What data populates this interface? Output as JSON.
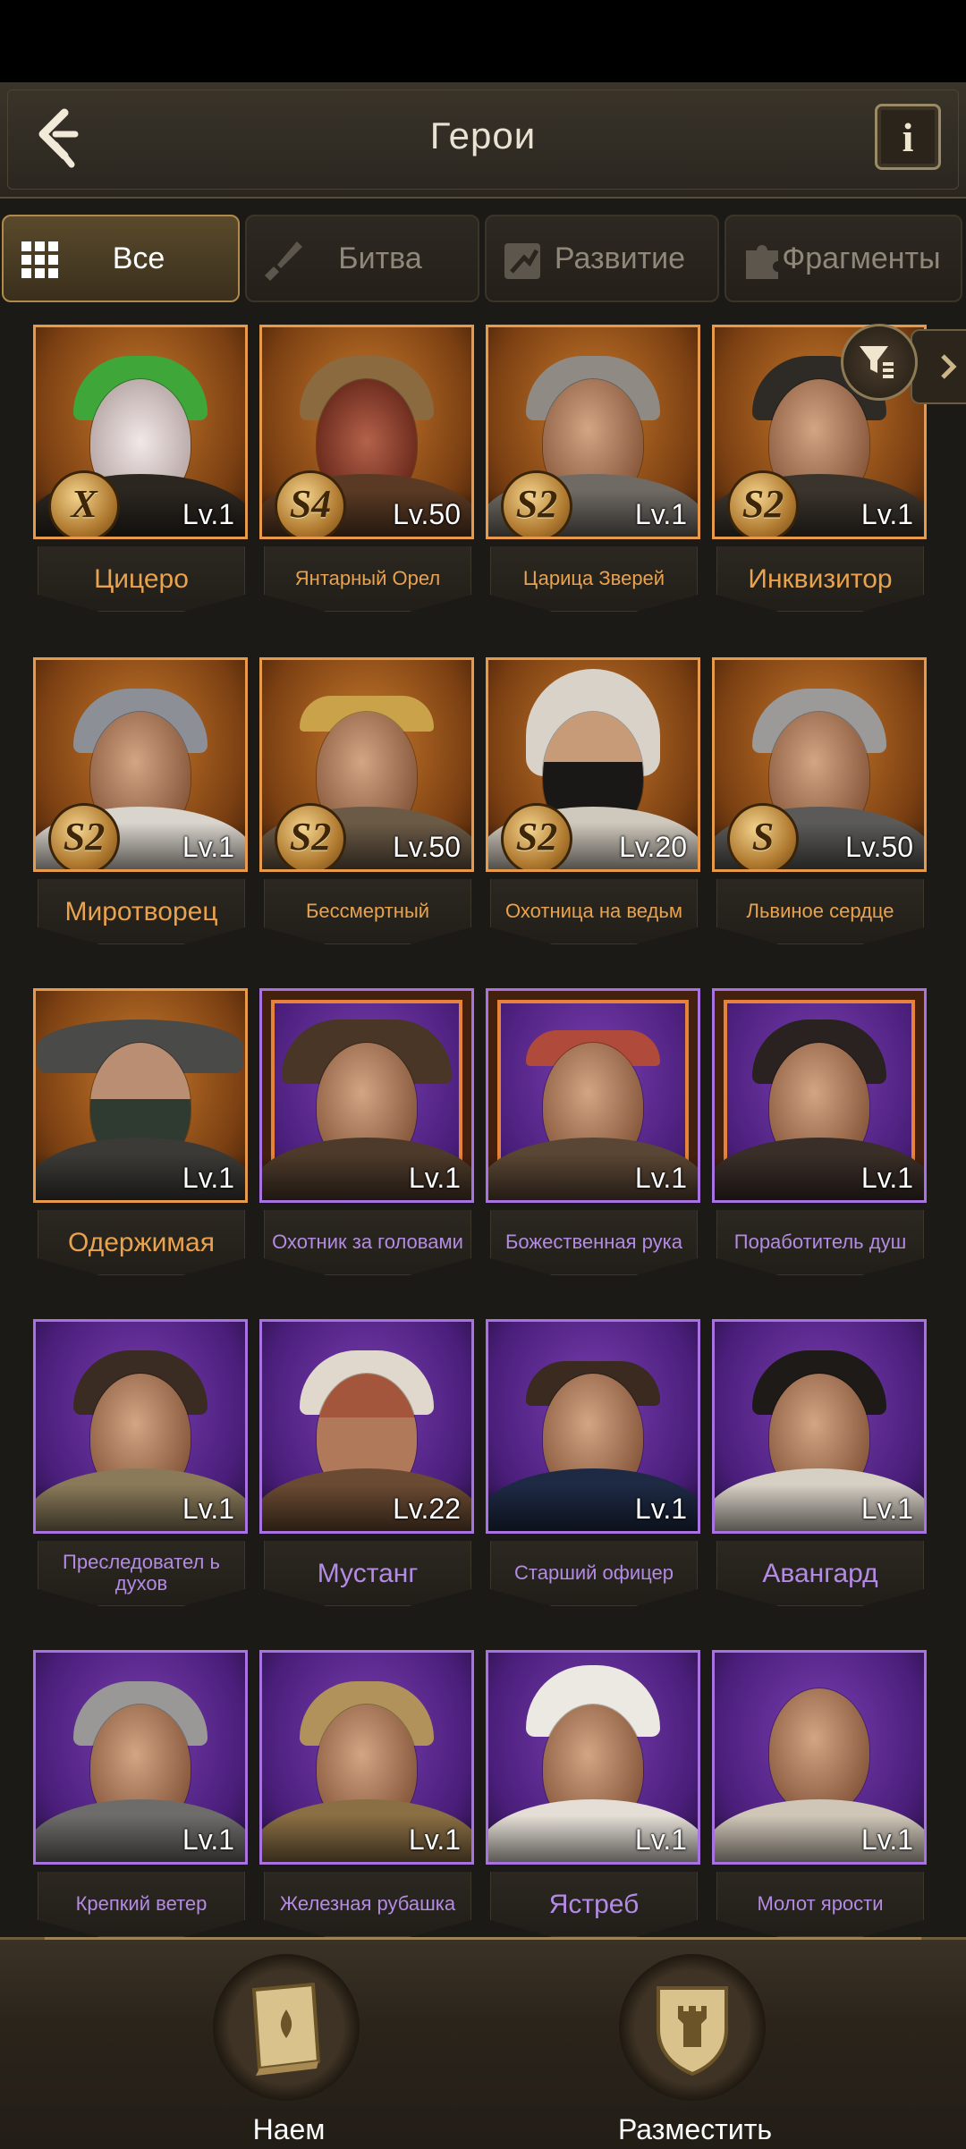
{
  "header": {
    "title": "Герои",
    "info_label": "i"
  },
  "tabs": [
    {
      "label": "Все"
    },
    {
      "label": "Битва"
    },
    {
      "label": "Развитие"
    },
    {
      "label": "Фрагменты"
    }
  ],
  "heroes": [
    {
      "name": "Цицеро",
      "level": "Lv.1",
      "badge": "X",
      "rarity": "orange"
    },
    {
      "name": "Янтарный Орел",
      "level": "Lv.50",
      "badge": "S4",
      "rarity": "orange"
    },
    {
      "name": "Царица Зверей",
      "level": "Lv.1",
      "badge": "S2",
      "rarity": "orange"
    },
    {
      "name": "Инквизитор",
      "level": "Lv.1",
      "badge": "S2",
      "rarity": "orange"
    },
    {
      "name": "Миротворец",
      "level": "Lv.1",
      "badge": "S2",
      "rarity": "orange"
    },
    {
      "name": "Бессмертный",
      "level": "Lv.50",
      "badge": "S2",
      "rarity": "orange"
    },
    {
      "name": "Охотница на ведьм",
      "level": "Lv.20",
      "badge": "S2",
      "rarity": "orange"
    },
    {
      "name": "Львиное сердце",
      "level": "Lv.50",
      "badge": "S",
      "rarity": "orange"
    },
    {
      "name": "Одержимая",
      "level": "Lv.1",
      "badge": "",
      "rarity": "orange"
    },
    {
      "name": "Охотник за головами",
      "level": "Lv.1",
      "badge": "",
      "rarity": "purple"
    },
    {
      "name": "Божественная рука",
      "level": "Lv.1",
      "badge": "",
      "rarity": "purple"
    },
    {
      "name": "Поработитель душ",
      "level": "Lv.1",
      "badge": "",
      "rarity": "purple"
    },
    {
      "name": "Преследовател ь духов",
      "level": "Lv.1",
      "badge": "",
      "rarity": "purple"
    },
    {
      "name": "Мустанг",
      "level": "Lv.22",
      "badge": "",
      "rarity": "purple"
    },
    {
      "name": "Старший офицер",
      "level": "Lv.1",
      "badge": "",
      "rarity": "purple"
    },
    {
      "name": "Авангард",
      "level": "Lv.1",
      "badge": "",
      "rarity": "purple"
    },
    {
      "name": "Крепкий ветер",
      "level": "Lv.1",
      "badge": "",
      "rarity": "purple"
    },
    {
      "name": "Железная рубашка",
      "level": "Lv.1",
      "badge": "",
      "rarity": "purple"
    },
    {
      "name": "Ястреб",
      "level": "Lv.1",
      "badge": "",
      "rarity": "purple"
    },
    {
      "name": "Молот ярости",
      "level": "Lv.1",
      "badge": "",
      "rarity": "purple"
    }
  ],
  "bottom": {
    "recruit_label": "Наем",
    "deploy_label": "Разместить"
  }
}
